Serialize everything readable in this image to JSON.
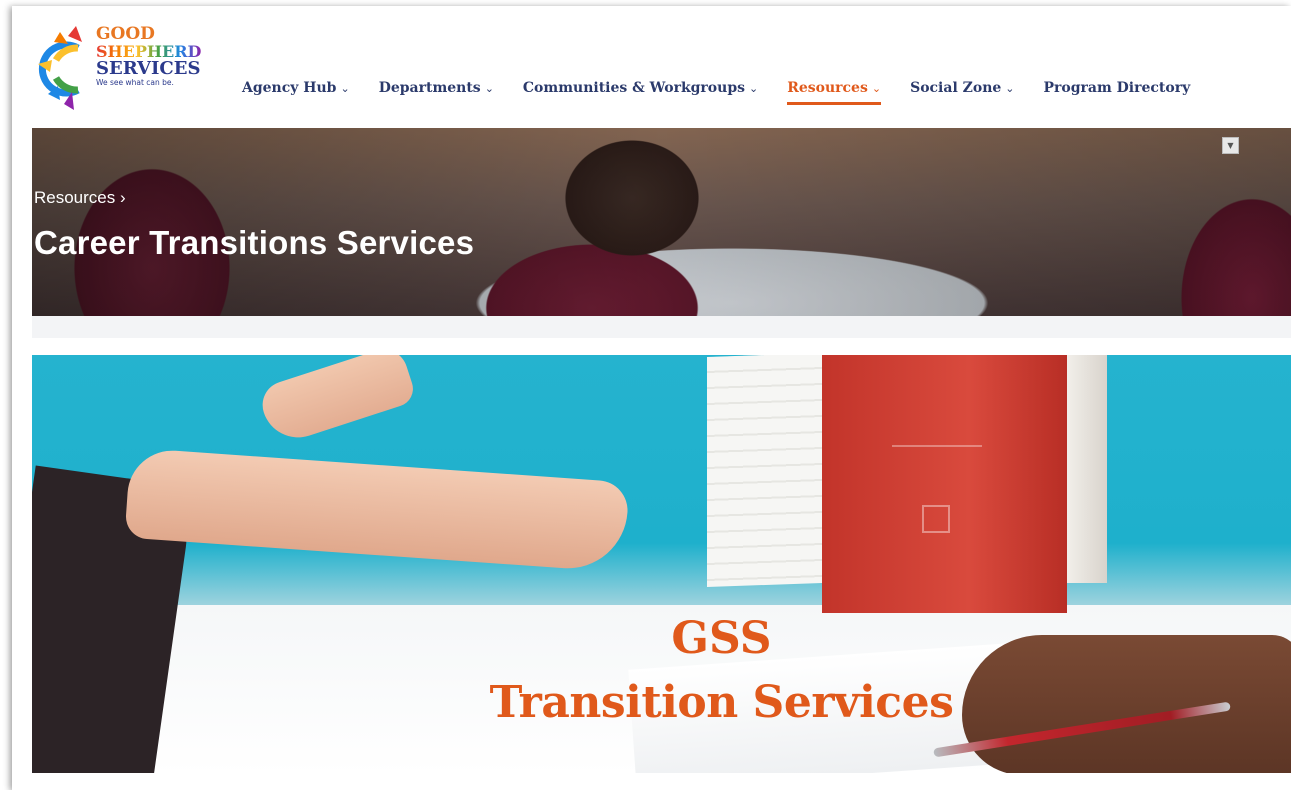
{
  "logo": {
    "line1": "GOOD",
    "line2": "SHEPHERD",
    "line3": "SERVICES",
    "tagline": "We see what can be."
  },
  "nav": {
    "items": [
      {
        "label": "Agency Hub",
        "dropdown": true
      },
      {
        "label": "Departments",
        "dropdown": true
      },
      {
        "label": "Communities & Workgroups",
        "dropdown": true
      },
      {
        "label": "Resources",
        "dropdown": true,
        "active": true
      },
      {
        "label": "Social Zone",
        "dropdown": true
      },
      {
        "label": "Program Directory",
        "dropdown": false
      }
    ],
    "chevron": "⌄",
    "active_color": "#e0591b"
  },
  "hero": {
    "breadcrumb": "Resources ›",
    "title": "Career Transitions Services"
  },
  "banner": {
    "line1": "GSS",
    "line2": "Transition Services",
    "text_color": "#e0591b"
  },
  "icons": {
    "dropdown_toggle": "chevron-down-icon"
  }
}
